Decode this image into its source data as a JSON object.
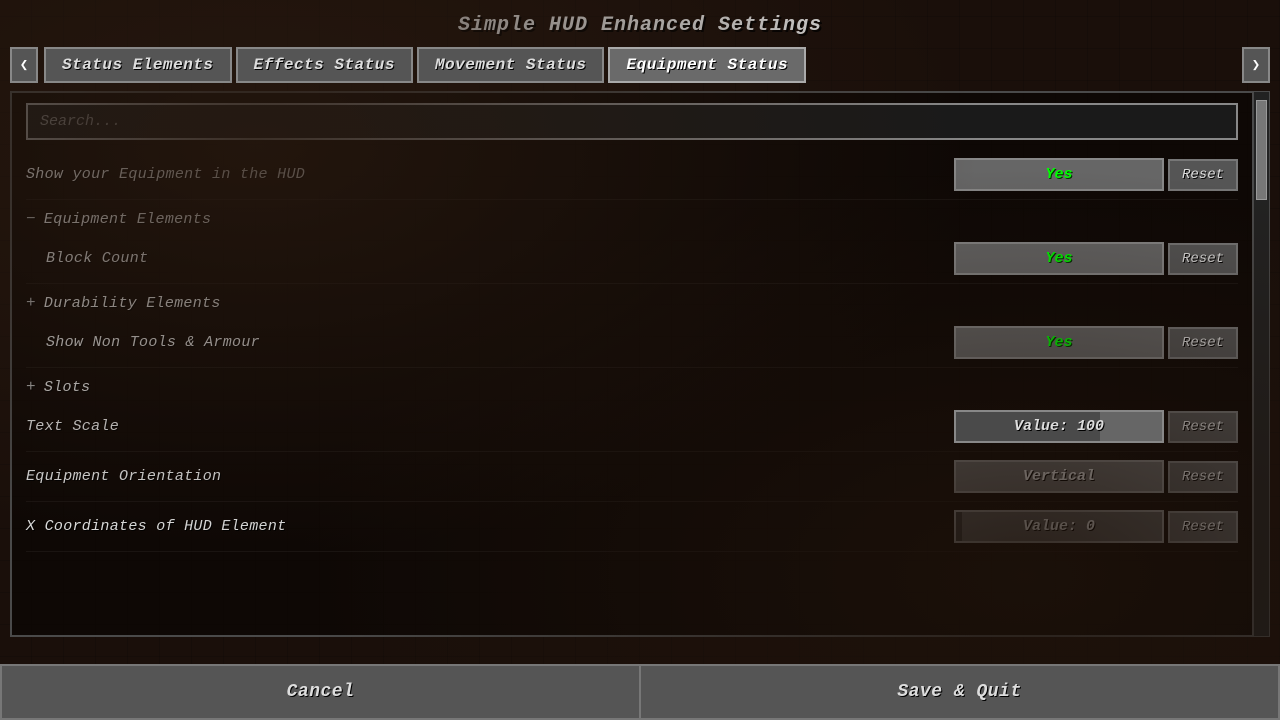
{
  "title": "Simple HUD Enhanced Settings",
  "tabs": [
    {
      "id": "status-elements",
      "label": "Status Elements",
      "active": false
    },
    {
      "id": "effects-status",
      "label": "Effects Status",
      "active": false
    },
    {
      "id": "movement-status",
      "label": "Movement Status",
      "active": false
    },
    {
      "id": "equipment-status",
      "label": "Equipment Status",
      "active": true
    }
  ],
  "left_arrow": "❮",
  "right_arrow": "❯",
  "search": {
    "placeholder": "Search..."
  },
  "settings": [
    {
      "type": "setting",
      "label": "Show your Equipment in the HUD",
      "value": "Yes",
      "value_color": "green",
      "show_reset": true
    },
    {
      "type": "section",
      "label": "Equipment Elements",
      "collapsed": false,
      "toggle": "−"
    },
    {
      "type": "setting",
      "label": "Block Count",
      "value": "Yes",
      "value_color": "green",
      "show_reset": true,
      "indented": true
    },
    {
      "type": "section",
      "label": "Durability Elements",
      "collapsed": true,
      "toggle": "+"
    },
    {
      "type": "setting",
      "label": "Show Non Tools & Armour",
      "value": "Yes",
      "value_color": "green",
      "show_reset": true,
      "indented": true
    },
    {
      "type": "section",
      "label": "Slots",
      "collapsed": true,
      "toggle": "+"
    },
    {
      "type": "setting",
      "label": "Text Scale",
      "value": "Value: 100",
      "value_color": "white",
      "show_reset": true,
      "slider": true,
      "slider_pct": 70
    },
    {
      "type": "setting",
      "label": "Equipment Orientation",
      "value": "Vertical",
      "value_color": "white",
      "show_reset": true
    },
    {
      "type": "setting",
      "label": "X Coordinates of HUD Element",
      "value": "Value: 0",
      "value_color": "white",
      "show_reset": true,
      "slider": true,
      "slider_pct": 3
    }
  ],
  "footer": {
    "cancel_label": "Cancel",
    "save_label": "Save & Quit"
  }
}
